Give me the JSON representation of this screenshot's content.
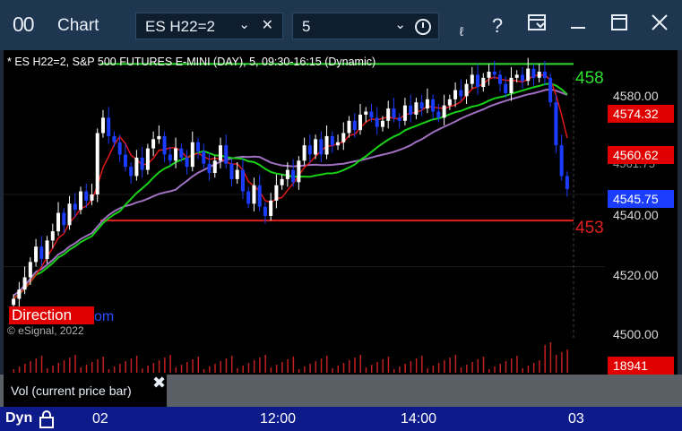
{
  "titlebar": {
    "app_icon": "00",
    "title": "Chart",
    "symbol_field": "ES H22=2",
    "interval_field": "5",
    "icons": [
      "chevron-down-icon",
      "clear-icon",
      "clock-icon",
      "draw-icon",
      "help-icon",
      "template-icon",
      "minimize-icon",
      "maximize-icon",
      "close-icon"
    ]
  },
  "chart": {
    "header": "* ES H22=2, S&P 500 FUTURES E-MINI (DAY), 5, 09:30-16:15 (Dynamic)",
    "copyright": "© eSignal, 2022",
    "direction_label": "Direction",
    "direction_suffix": "om",
    "upper_line_label": "458",
    "lower_line_label": "453",
    "price_ticks": [
      "4580.00",
      "4540.00",
      "4520.00",
      "4500.00"
    ],
    "price_tags": {
      "red_upper": "4574.32",
      "red_lower": "4560.62",
      "partial": "4561.75",
      "blue_last": "4545.75",
      "volume": "18941"
    },
    "colors": {
      "up": "#ffffff",
      "down": "#1a3dff",
      "fast_ma": "#e01818",
      "slow_ma": "#18d018",
      "long_ma": "#a070c0",
      "level_green": "#2ee02e",
      "level_red": "#e02020",
      "volume": "#c02020"
    }
  },
  "chart_data": {
    "type": "candlestick",
    "ylim": [
      4497,
      4591
    ],
    "upper_level": 4586.5,
    "lower_level": 4535.5,
    "close_series": [
      4510,
      4513,
      4517,
      4522,
      4527,
      4523,
      4529,
      4532,
      4538,
      4534,
      4541,
      4539,
      4545,
      4542,
      4544,
      4564,
      4569,
      4563,
      4561,
      4557,
      4553,
      4550,
      4556,
      4552,
      4559,
      4562,
      4563,
      4557,
      4555,
      4559,
      4556,
      4553,
      4561,
      4558,
      4554,
      4551,
      4555,
      4560,
      4554,
      4549,
      4552,
      4545,
      4541,
      4547,
      4540,
      4537,
      4542,
      4547,
      4549,
      4552,
      4548,
      4555,
      4560,
      4557,
      4562,
      4557,
      4563,
      4560,
      4561,
      4564,
      4568,
      4565,
      4570,
      4571,
      4569,
      4566,
      4568,
      4572,
      4569,
      4568,
      4573,
      4570,
      4574,
      4572,
      4575,
      4571,
      4569,
      4573,
      4575,
      4578,
      4576,
      4580,
      4583,
      4579,
      4582,
      4584,
      4583,
      4580,
      4577,
      4582,
      4583,
      4581,
      4585,
      4582,
      4584,
      4582,
      4574,
      4560,
      4550,
      4545.75
    ],
    "x_labels": [
      "02",
      "12:00",
      "14:00",
      "03"
    ],
    "volume_label": "Vol (current price bar)",
    "volume_last": 18941
  },
  "volume_panel": {
    "label": "Vol (current price bar)"
  },
  "time_axis": {
    "mode": "Dyn",
    "labels": [
      "02",
      "12:00",
      "14:00",
      "03"
    ]
  }
}
